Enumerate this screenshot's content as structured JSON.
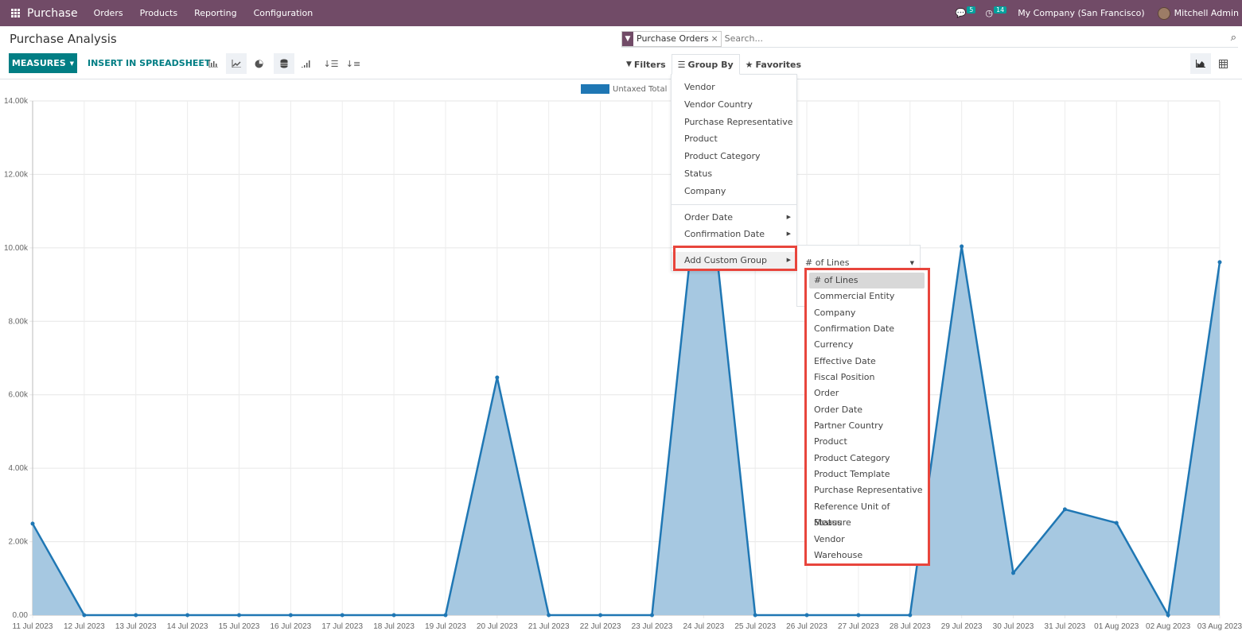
{
  "topbar": {
    "app_name": "Purchase",
    "menu": [
      "Orders",
      "Products",
      "Reporting",
      "Configuration"
    ],
    "messages_count": "5",
    "activities_count": "14",
    "company": "My Company (San Francisco)",
    "user": "Mitchell Admin"
  },
  "page": {
    "title": "Purchase Analysis"
  },
  "search": {
    "facet_label": "Purchase Orders",
    "facet_remove": "×",
    "placeholder": "Search..."
  },
  "toolbar": {
    "measures_label": "MEASURES",
    "insert_label": "INSERT IN SPREADSHEET",
    "filters_label": "Filters",
    "groupby_label": "Group By",
    "favorites_label": "Favorites"
  },
  "groupby_menu": {
    "items": [
      "Vendor",
      "Vendor Country",
      "Purchase Representative",
      "Product",
      "Product Category",
      "Status",
      "Company"
    ],
    "date_items": [
      "Order Date",
      "Confirmation Date"
    ],
    "custom_group_label": "Add Custom Group",
    "custom_select_value": "# of Lines",
    "custom_options": [
      "# of Lines",
      "Commercial Entity",
      "Company",
      "Confirmation Date",
      "Currency",
      "Effective Date",
      "Fiscal Position",
      "Order",
      "Order Date",
      "Partner Country",
      "Product",
      "Product Category",
      "Product Template",
      "Purchase Representative",
      "Reference Unit of Measure",
      "Status",
      "Vendor",
      "Warehouse"
    ],
    "selected_option": "# of Lines"
  },
  "colors": {
    "brand": "#714b67",
    "accent": "#017e84",
    "series": "#1f77b4",
    "fill": "#a6c8e1",
    "highlight": "#e8453c"
  },
  "chart_data": {
    "type": "area",
    "title": "",
    "xlabel": "",
    "ylabel": "",
    "legend": "top-center",
    "grid": true,
    "ylim": [
      0,
      14000
    ],
    "yticks": [
      "0.00",
      "2.00k",
      "4.00k",
      "6.00k",
      "8.00k",
      "10.00k",
      "12.00k",
      "14.00k"
    ],
    "categories": [
      "11 Jul 2023",
      "12 Jul 2023",
      "13 Jul 2023",
      "14 Jul 2023",
      "15 Jul 2023",
      "16 Jul 2023",
      "17 Jul 2023",
      "18 Jul 2023",
      "19 Jul 2023",
      "20 Jul 2023",
      "21 Jul 2023",
      "22 Jul 2023",
      "23 Jul 2023",
      "24 Jul 2023",
      "25 Jul 2023",
      "26 Jul 2023",
      "27 Jul 2023",
      "28 Jul 2023",
      "29 Jul 2023",
      "30 Jul 2023",
      "31 Jul 2023",
      "01 Aug 2023",
      "02 Aug 2023",
      "03 Aug 2023"
    ],
    "series": [
      {
        "name": "Untaxed Total",
        "values": [
          2490,
          0,
          0,
          0,
          0,
          0,
          0,
          0,
          0,
          6470,
          0,
          0,
          0,
          13200,
          0,
          0,
          0,
          0,
          10040,
          1150,
          2880,
          2510,
          0,
          9610
        ]
      }
    ]
  }
}
